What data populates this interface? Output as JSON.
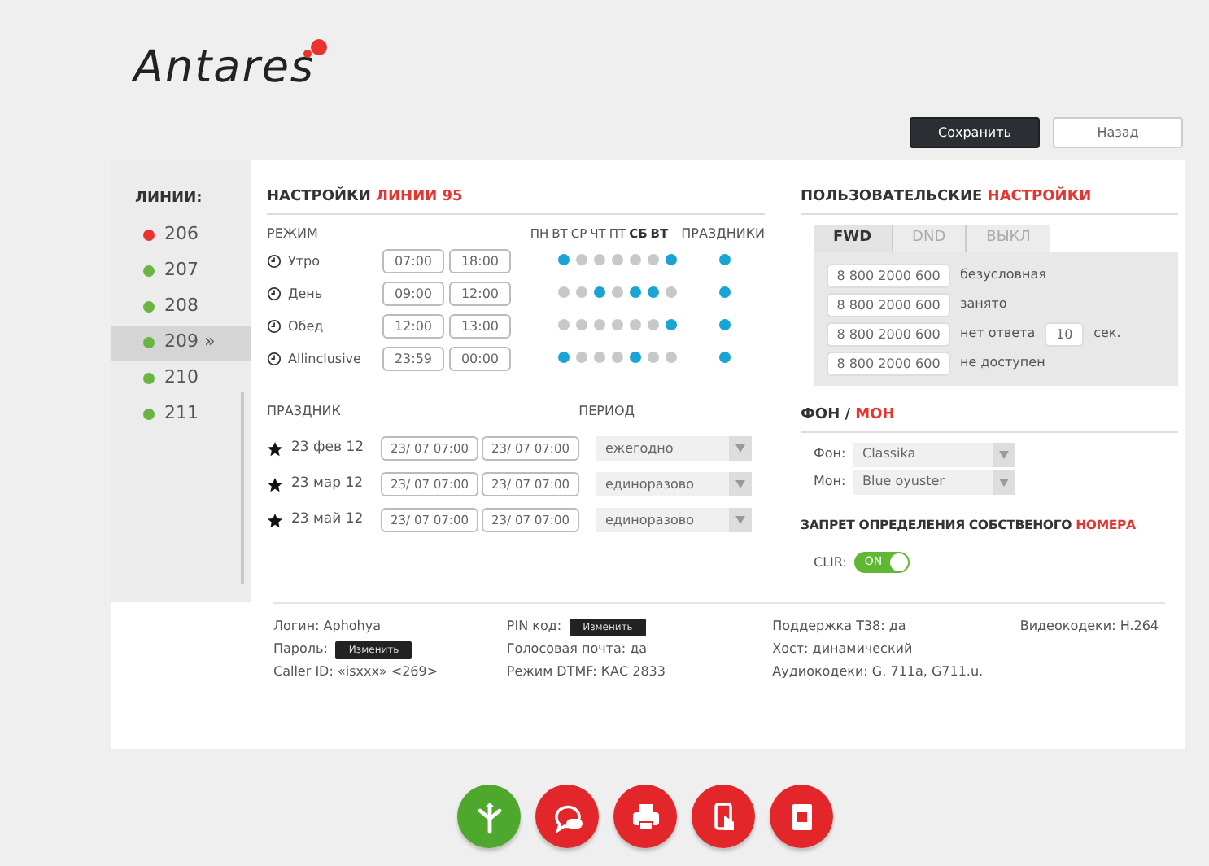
{
  "logo": {
    "text": "Antares"
  },
  "header_buttons": [
    {
      "label": "Сохранить",
      "kind": "primary"
    },
    {
      "label": "Назад",
      "kind": "secondary"
    }
  ],
  "sidebar": {
    "title": "ЛИНИИ:",
    "items": [
      {
        "label": "206",
        "color": "#e8332e",
        "selected": false
      },
      {
        "label": "207",
        "color": "#6ab344",
        "selected": false
      },
      {
        "label": "208",
        "color": "#6ab344",
        "selected": false
      },
      {
        "label": "209",
        "suffix": "»",
        "color": "#6ab344",
        "selected": true
      },
      {
        "label": "210",
        "color": "#6ab344",
        "selected": false
      },
      {
        "label": "211",
        "color": "#6ab344",
        "selected": false
      }
    ]
  },
  "line_settings": {
    "title": "НАСТРОЙКИ",
    "title_accent": "ЛИНИИ 95",
    "mode_label": "РЕЖИМ",
    "days": [
      {
        "label": "ПН",
        "bold": false
      },
      {
        "label": "ВТ",
        "bold": false
      },
      {
        "label": "СР",
        "bold": false
      },
      {
        "label": "ЧТ",
        "bold": false
      },
      {
        "label": "ПТ",
        "bold": false
      },
      {
        "label": "СБ",
        "bold": true
      },
      {
        "label": "ВТ",
        "bold": true
      }
    ],
    "holidays_label": "ПРАЗДНИКИ",
    "modes": [
      {
        "name": "Утро",
        "from": "07:00",
        "to": "18:00",
        "days": [
          true,
          false,
          false,
          false,
          false,
          false,
          true
        ],
        "holiday": true
      },
      {
        "name": "День",
        "from": "09:00",
        "to": "12:00",
        "days": [
          false,
          false,
          true,
          false,
          true,
          true,
          false
        ],
        "holiday": true
      },
      {
        "name": "Обед",
        "from": "12:00",
        "to": "13:00",
        "days": [
          false,
          false,
          false,
          false,
          false,
          false,
          true
        ],
        "holiday": true
      },
      {
        "name": "Allinclusive",
        "from": "23:59",
        "to": "00:00",
        "days": [
          true,
          false,
          false,
          false,
          true,
          false,
          false
        ],
        "holiday": true
      }
    ],
    "holiday_label": "ПРАЗДНИК",
    "period_label": "ПЕРИОД",
    "holidays": [
      {
        "date": "23 фев 12",
        "from": "23/ 07 07:00",
        "to": "23/ 07 07:00",
        "period": "ежегодно"
      },
      {
        "date": "23 мар 12",
        "from": "23/ 07 07:00",
        "to": "23/ 07 07:00",
        "period": "единоразово"
      },
      {
        "date": "23 май 12",
        "from": "23/ 07 07:00",
        "to": "23/ 07 07:00",
        "period": "единоразово"
      }
    ]
  },
  "user_settings": {
    "title": "ПОЛЬЗОВАТЕЛЬСКИЕ",
    "title_accent": "НАСТРОЙКИ",
    "tabs": [
      {
        "label": "FWD",
        "selected": true
      },
      {
        "label": "DND",
        "selected": false
      },
      {
        "label": "ВЫКЛ",
        "selected": false
      }
    ],
    "forwards": [
      {
        "number": "8 800 2000 600",
        "label": "безусловная"
      },
      {
        "number": "8 800 2000 600",
        "label": "занято"
      },
      {
        "number": "8 800 2000 600",
        "label": "нет ответа",
        "seconds": "10",
        "unit": "сек."
      },
      {
        "number": "8 800 2000 600",
        "label": "не доступен"
      }
    ]
  },
  "background": {
    "title": "ФОН /",
    "title_accent": "МОН",
    "selects": [
      {
        "label": "Фон:",
        "value": "Classika"
      },
      {
        "label": "Мон:",
        "value": "Blue oyuster"
      }
    ]
  },
  "clir": {
    "title": "ЗАПРЕТ ОПРЕДЕЛЕНИЯ СОБСТВЕНОГО",
    "title_accent": "НОМЕРА",
    "label": "CLIR:",
    "on": true,
    "on_text": "ON"
  },
  "info": [
    [
      {
        "label": "Логин:",
        "value": "Aphohya"
      },
      {
        "label": "Пароль:",
        "button": "Изменить"
      },
      {
        "label": "Caller ID:",
        "value": "«isxxx» <269>"
      }
    ],
    [
      {
        "label": "PIN код:",
        "button": "Изменить"
      },
      {
        "label": "Голосовая почта:",
        "value": "да"
      },
      {
        "label": "Режим DTMF:",
        "value": "КАС 2833"
      }
    ],
    [
      {
        "label": "Поддержка T38:",
        "value": "да"
      },
      {
        "label": "Хост:",
        "value": "динамический"
      },
      {
        "label": "Аудиокодеки:",
        "value": "G. 711a, G711.u."
      }
    ],
    [
      {
        "label": "Видеокодеки:",
        "value": "H.264"
      }
    ]
  ],
  "dock": [
    {
      "kind": "branch",
      "color": "#4fa82e"
    },
    {
      "kind": "chat",
      "color": "#e3262a"
    },
    {
      "kind": "printer",
      "color": "#e3262a"
    },
    {
      "kind": "phone",
      "color": "#e3262a"
    },
    {
      "kind": "contacts",
      "color": "#e3262a"
    }
  ]
}
